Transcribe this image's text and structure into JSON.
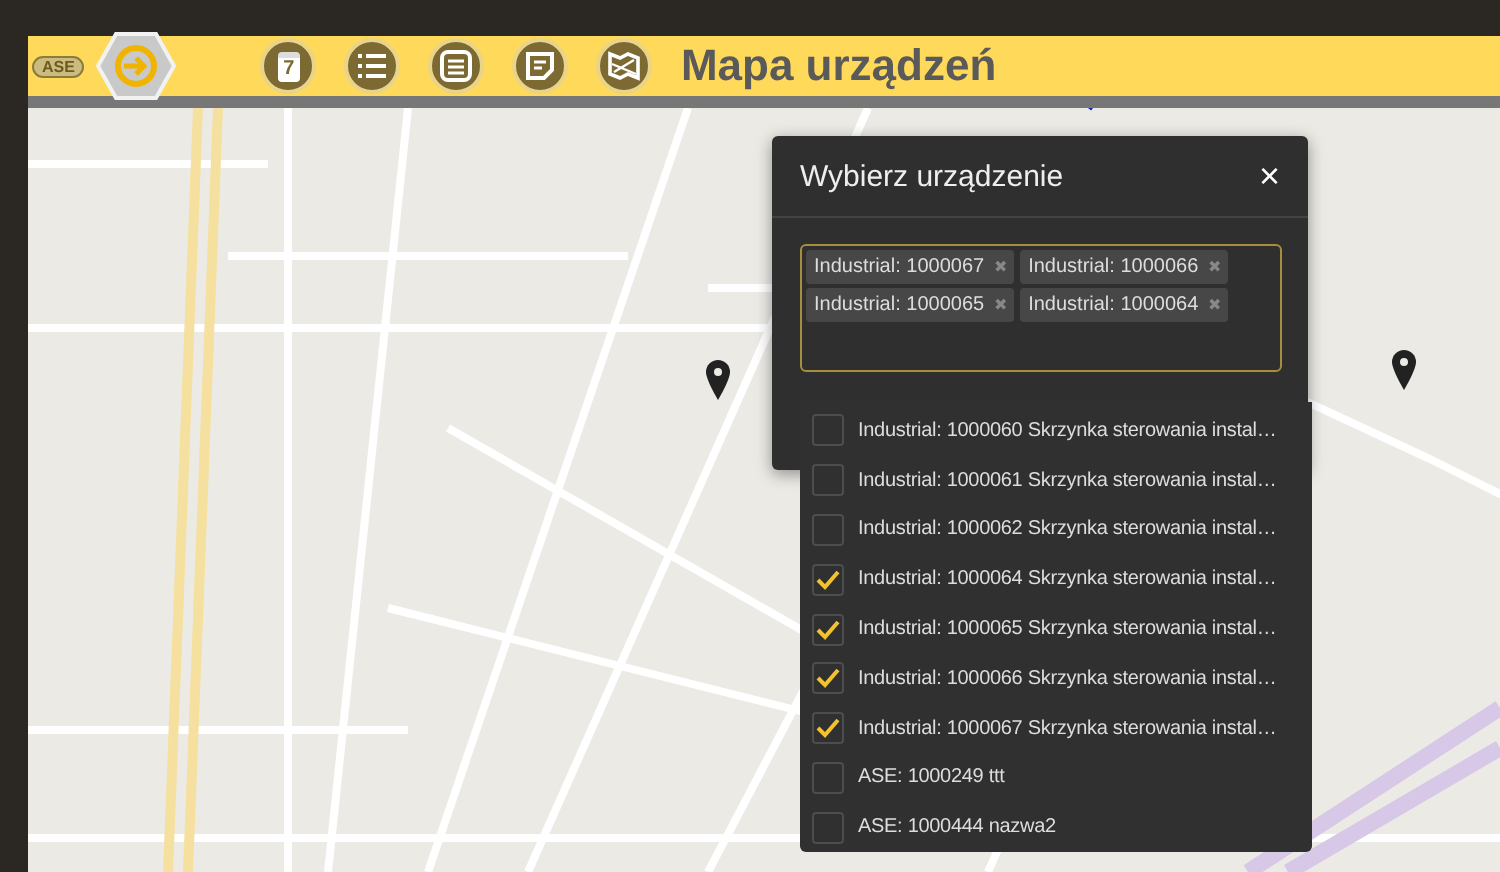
{
  "header": {
    "logo_text": "ASE",
    "calendar_day": "7",
    "title": "Mapa urządzeń"
  },
  "dialog": {
    "title": "Wybierz urządzenie",
    "close": "×",
    "selected_tags": [
      {
        "label": "Industrial: 1000067",
        "remove": "✖"
      },
      {
        "label": "Industrial: 1000066",
        "remove": "✖"
      },
      {
        "label": "Industrial: 1000065",
        "remove": "✖"
      },
      {
        "label": "Industrial: 1000064",
        "remove": "✖"
      }
    ],
    "options": [
      {
        "label": "Industrial: 1000060 Skrzynka sterowania instal…",
        "checked": false
      },
      {
        "label": "Industrial: 1000061 Skrzynka sterowania instal…",
        "checked": false
      },
      {
        "label": "Industrial: 1000062 Skrzynka sterowania instal…",
        "checked": false
      },
      {
        "label": "Industrial: 1000064 Skrzynka sterowania instal…",
        "checked": true
      },
      {
        "label": "Industrial: 1000065 Skrzynka sterowania instal…",
        "checked": true
      },
      {
        "label": "Industrial: 1000066 Skrzynka sterowania instal…",
        "checked": true
      },
      {
        "label": "Industrial: 1000067 Skrzynka sterowania instal…",
        "checked": true
      },
      {
        "label": "ASE: 1000249 ttt",
        "checked": false
      },
      {
        "label": "ASE: 1000444 nazwa2",
        "checked": false
      }
    ]
  }
}
